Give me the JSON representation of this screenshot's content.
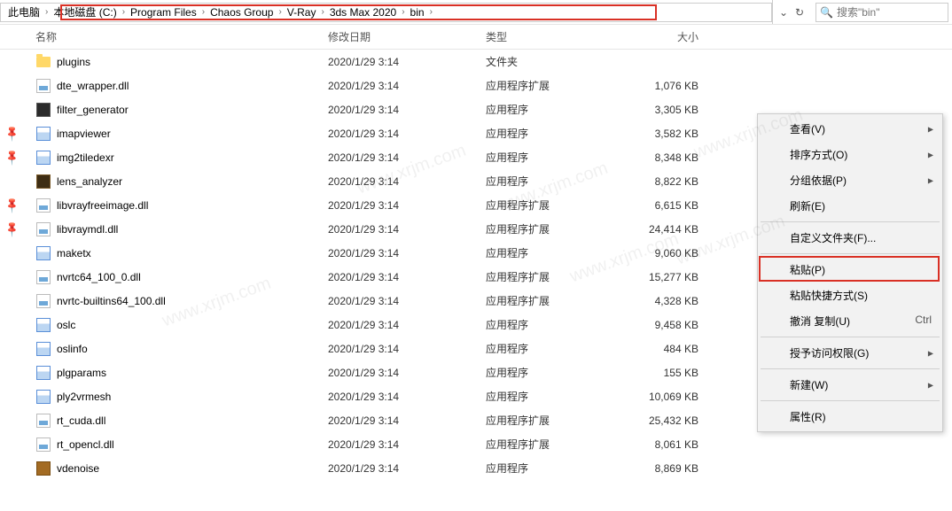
{
  "breadcrumb": {
    "segments": [
      "此电脑",
      "本地磁盘 (C:)",
      "Program Files",
      "Chaos Group",
      "V-Ray",
      "3ds Max 2020",
      "bin"
    ]
  },
  "search": {
    "placeholder": "搜索\"bin\""
  },
  "columns": {
    "name": "名称",
    "date": "修改日期",
    "type": "类型",
    "size": "大小"
  },
  "files": [
    {
      "icon": "folder",
      "name": "plugins",
      "date": "2020/1/29 3:14",
      "type": "文件夹",
      "size": ""
    },
    {
      "icon": "dll",
      "name": "dte_wrapper.dll",
      "date": "2020/1/29 3:14",
      "type": "应用程序扩展",
      "size": "1,076 KB"
    },
    {
      "icon": "custom1",
      "name": "filter_generator",
      "date": "2020/1/29 3:14",
      "type": "应用程序",
      "size": "3,305 KB"
    },
    {
      "icon": "exe",
      "name": "imapviewer",
      "date": "2020/1/29 3:14",
      "type": "应用程序",
      "size": "3,582 KB"
    },
    {
      "icon": "exe",
      "name": "img2tiledexr",
      "date": "2020/1/29 3:14",
      "type": "应用程序",
      "size": "8,348 KB"
    },
    {
      "icon": "custom2",
      "name": "lens_analyzer",
      "date": "2020/1/29 3:14",
      "type": "应用程序",
      "size": "8,822 KB"
    },
    {
      "icon": "dll",
      "name": "libvrayfreeimage.dll",
      "date": "2020/1/29 3:14",
      "type": "应用程序扩展",
      "size": "6,615 KB"
    },
    {
      "icon": "dll",
      "name": "libvraymdl.dll",
      "date": "2020/1/29 3:14",
      "type": "应用程序扩展",
      "size": "24,414 KB"
    },
    {
      "icon": "exe",
      "name": "maketx",
      "date": "2020/1/29 3:14",
      "type": "应用程序",
      "size": "9,060 KB"
    },
    {
      "icon": "dll",
      "name": "nvrtc64_100_0.dll",
      "date": "2020/1/29 3:14",
      "type": "应用程序扩展",
      "size": "15,277 KB"
    },
    {
      "icon": "dll",
      "name": "nvrtc-builtins64_100.dll",
      "date": "2020/1/29 3:14",
      "type": "应用程序扩展",
      "size": "4,328 KB"
    },
    {
      "icon": "exe",
      "name": "oslc",
      "date": "2020/1/29 3:14",
      "type": "应用程序",
      "size": "9,458 KB"
    },
    {
      "icon": "exe",
      "name": "oslinfo",
      "date": "2020/1/29 3:14",
      "type": "应用程序",
      "size": "484 KB"
    },
    {
      "icon": "exe",
      "name": "plgparams",
      "date": "2020/1/29 3:14",
      "type": "应用程序",
      "size": "155 KB"
    },
    {
      "icon": "exe",
      "name": "ply2vrmesh",
      "date": "2020/1/29 3:14",
      "type": "应用程序",
      "size": "10,069 KB"
    },
    {
      "icon": "dll",
      "name": "rt_cuda.dll",
      "date": "2020/1/29 3:14",
      "type": "应用程序扩展",
      "size": "25,432 KB"
    },
    {
      "icon": "dll",
      "name": "rt_opencl.dll",
      "date": "2020/1/29 3:14",
      "type": "应用程序扩展",
      "size": "8,061 KB"
    },
    {
      "icon": "custom3",
      "name": "vdenoise",
      "date": "2020/1/29 3:14",
      "type": "应用程序",
      "size": "8,869 KB"
    }
  ],
  "pins": [
    3,
    4,
    6,
    7
  ],
  "context_menu": {
    "items": [
      {
        "label": "查看(V)",
        "sub": true
      },
      {
        "label": "排序方式(O)",
        "sub": true
      },
      {
        "label": "分组依据(P)",
        "sub": true
      },
      {
        "label": "刷新(E)"
      },
      {
        "sep": true
      },
      {
        "label": "自定义文件夹(F)..."
      },
      {
        "sep": true
      },
      {
        "label": "粘贴(P)",
        "highlight": true
      },
      {
        "label": "粘贴快捷方式(S)"
      },
      {
        "label": "撤消 复制(U)",
        "shortcut": "Ctrl"
      },
      {
        "sep": true
      },
      {
        "label": "授予访问权限(G)",
        "sub": true
      },
      {
        "sep": true
      },
      {
        "label": "新建(W)",
        "sub": true
      },
      {
        "sep": true
      },
      {
        "label": "属性(R)"
      }
    ]
  },
  "watermark": "www.xrjm.com"
}
